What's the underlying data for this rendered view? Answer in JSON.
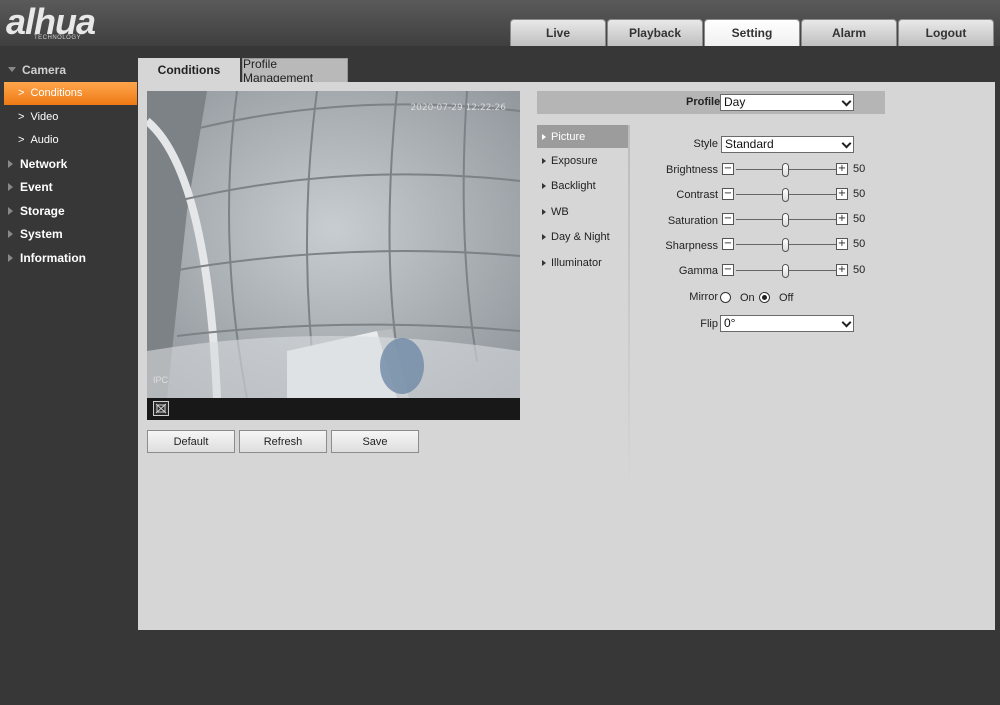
{
  "brand": {
    "logo": "alhua",
    "tagline": "TECHNOLOGY"
  },
  "topnav": [
    {
      "label": "Live"
    },
    {
      "label": "Playback"
    },
    {
      "label": "Setting"
    },
    {
      "label": "Alarm"
    },
    {
      "label": "Logout"
    }
  ],
  "sidebar": {
    "camera": "Camera",
    "items": [
      {
        "label": "Conditions"
      },
      {
        "label": "Video"
      },
      {
        "label": "Audio"
      }
    ],
    "groups": [
      {
        "label": "Network"
      },
      {
        "label": "Event"
      },
      {
        "label": "Storage"
      },
      {
        "label": "System"
      },
      {
        "label": "Information"
      }
    ]
  },
  "tabs": [
    {
      "label": "Conditions"
    },
    {
      "label": "Profile Management"
    }
  ],
  "video": {
    "timestamp": "2020-07-29 12:22:26",
    "channel": "IPC"
  },
  "buttons": {
    "default": "Default",
    "refresh": "Refresh",
    "save": "Save"
  },
  "profile": {
    "label": "Profile",
    "value": "Day"
  },
  "submenu": [
    {
      "label": "Picture"
    },
    {
      "label": "Exposure"
    },
    {
      "label": "Backlight"
    },
    {
      "label": "WB"
    },
    {
      "label": "Day & Night"
    },
    {
      "label": "Illuminator"
    }
  ],
  "settings": {
    "style_label": "Style",
    "style_value": "Standard",
    "brightness_label": "Brightness",
    "brightness": "50",
    "contrast_label": "Contrast",
    "contrast": "50",
    "saturation_label": "Saturation",
    "saturation": "50",
    "sharpness_label": "Sharpness",
    "sharpness": "50",
    "gamma_label": "Gamma",
    "gamma": "50",
    "mirror_label": "Mirror",
    "mirror_on": "On",
    "mirror_off": "Off",
    "mirror_selected": "Off",
    "flip_label": "Flip",
    "flip_value": "0°"
  },
  "colors": {
    "accent": "#f08a24",
    "background": "#373737",
    "panel": "#d6d6d6"
  }
}
